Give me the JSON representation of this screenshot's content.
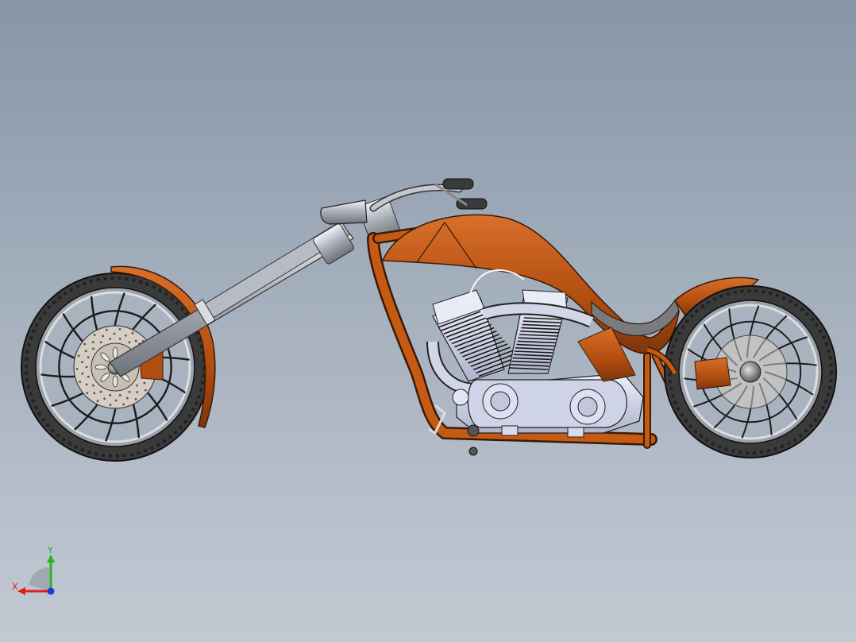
{
  "viewport": {
    "background_top": "#8795a7",
    "background_bottom": "#c2c9d3"
  },
  "model": {
    "subject": "chopper-motorcycle",
    "view": "side",
    "colors": {
      "frame": "#c55a14",
      "frame_dark": "#7d350b",
      "chrome": "#c3c7ce",
      "engine": "#cfd3e8",
      "tire": "#3a3a3a",
      "rim": "#e6e6e6",
      "disc": "#d6cec4",
      "outline": "#1a1a1a"
    }
  },
  "triad": {
    "x_label": "X",
    "y_label": "Y",
    "x_color": "#e0201c",
    "y_color": "#27b21e",
    "z_color": "#1a3cd8"
  }
}
